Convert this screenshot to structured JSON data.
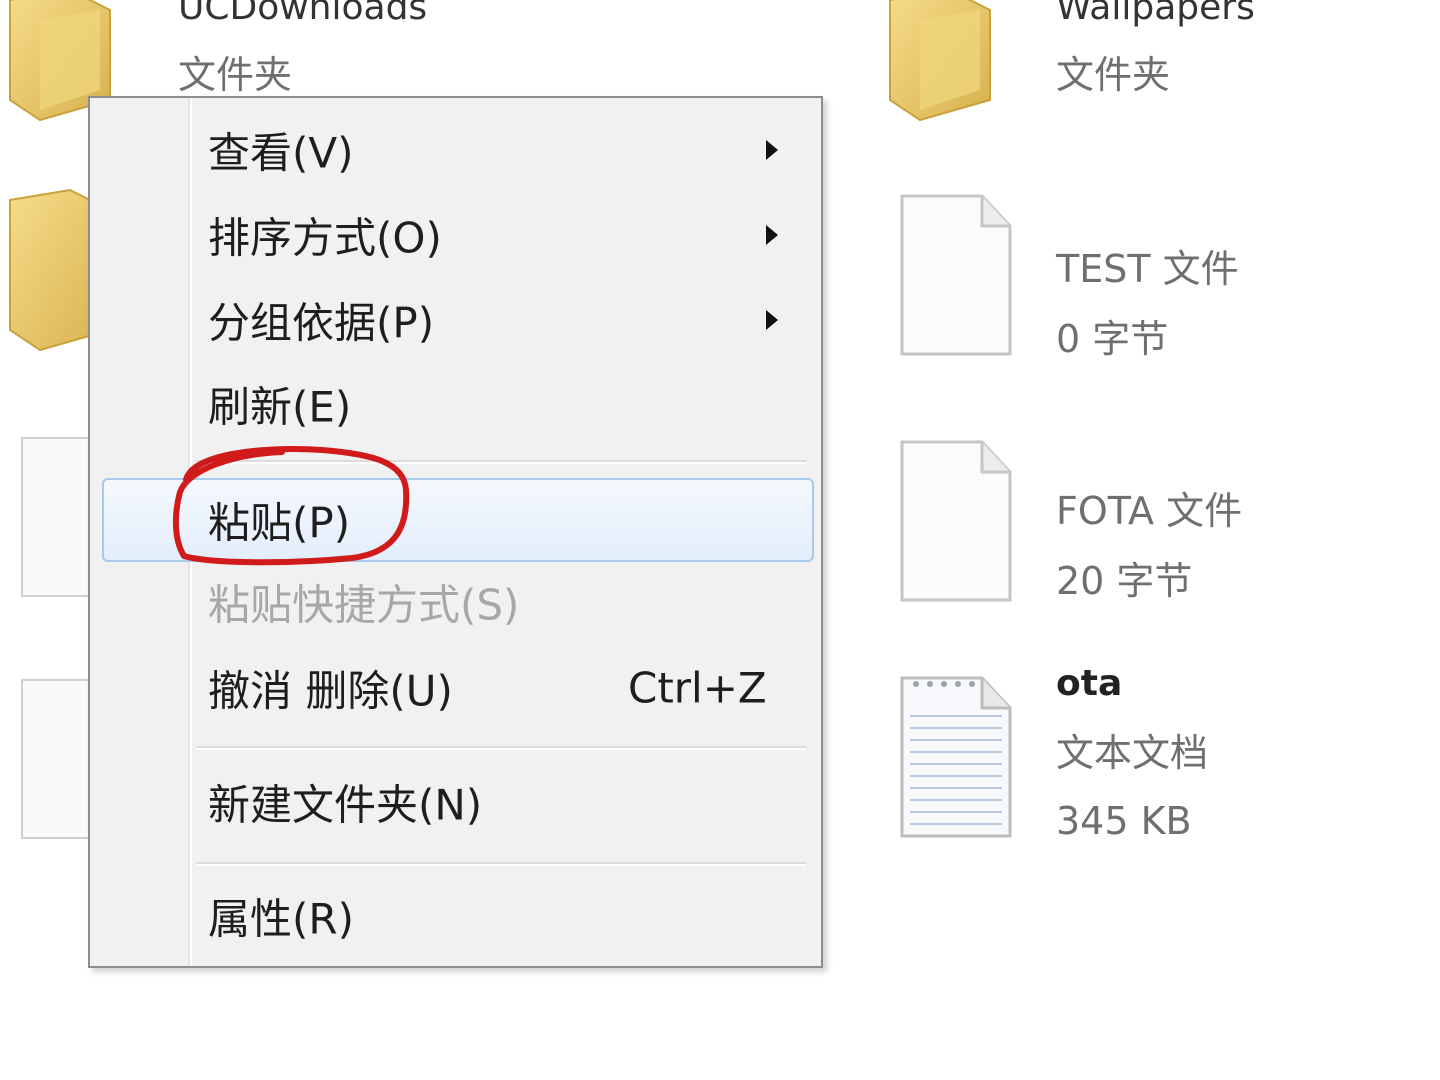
{
  "explorer": {
    "items": [
      {
        "name": "UCDownloads",
        "type": "文件夹"
      },
      {
        "name": "Wallpapers",
        "type": "文件夹"
      },
      {
        "name": "TEST 文件",
        "size": "0 字节"
      },
      {
        "name": "FOTA 文件",
        "size": "20 字节"
      },
      {
        "name": "ota",
        "type": "文本文档",
        "size": "345 KB"
      }
    ]
  },
  "context_menu": {
    "items": [
      {
        "label": "查看(V)",
        "submenu": true
      },
      {
        "label": "排序方式(O)",
        "submenu": true
      },
      {
        "label": "分组依据(P)",
        "submenu": true
      },
      {
        "label": "刷新(E)"
      },
      {
        "label": "粘贴(P)",
        "state": "hover"
      },
      {
        "label": "粘贴快捷方式(S)",
        "state": "disabled"
      },
      {
        "label": "撤消 删除(U)",
        "shortcut": "Ctrl+Z"
      },
      {
        "label": "新建文件夹(N)"
      },
      {
        "label": "属性(R)"
      }
    ]
  },
  "colors": {
    "folder": "#e9c866",
    "highlight_border": "#a9c8ea",
    "annotation": "#d11a1a"
  },
  "icons": {
    "folder": "folder-icon",
    "blank_file": "file-icon",
    "text_document": "text-document-icon"
  }
}
